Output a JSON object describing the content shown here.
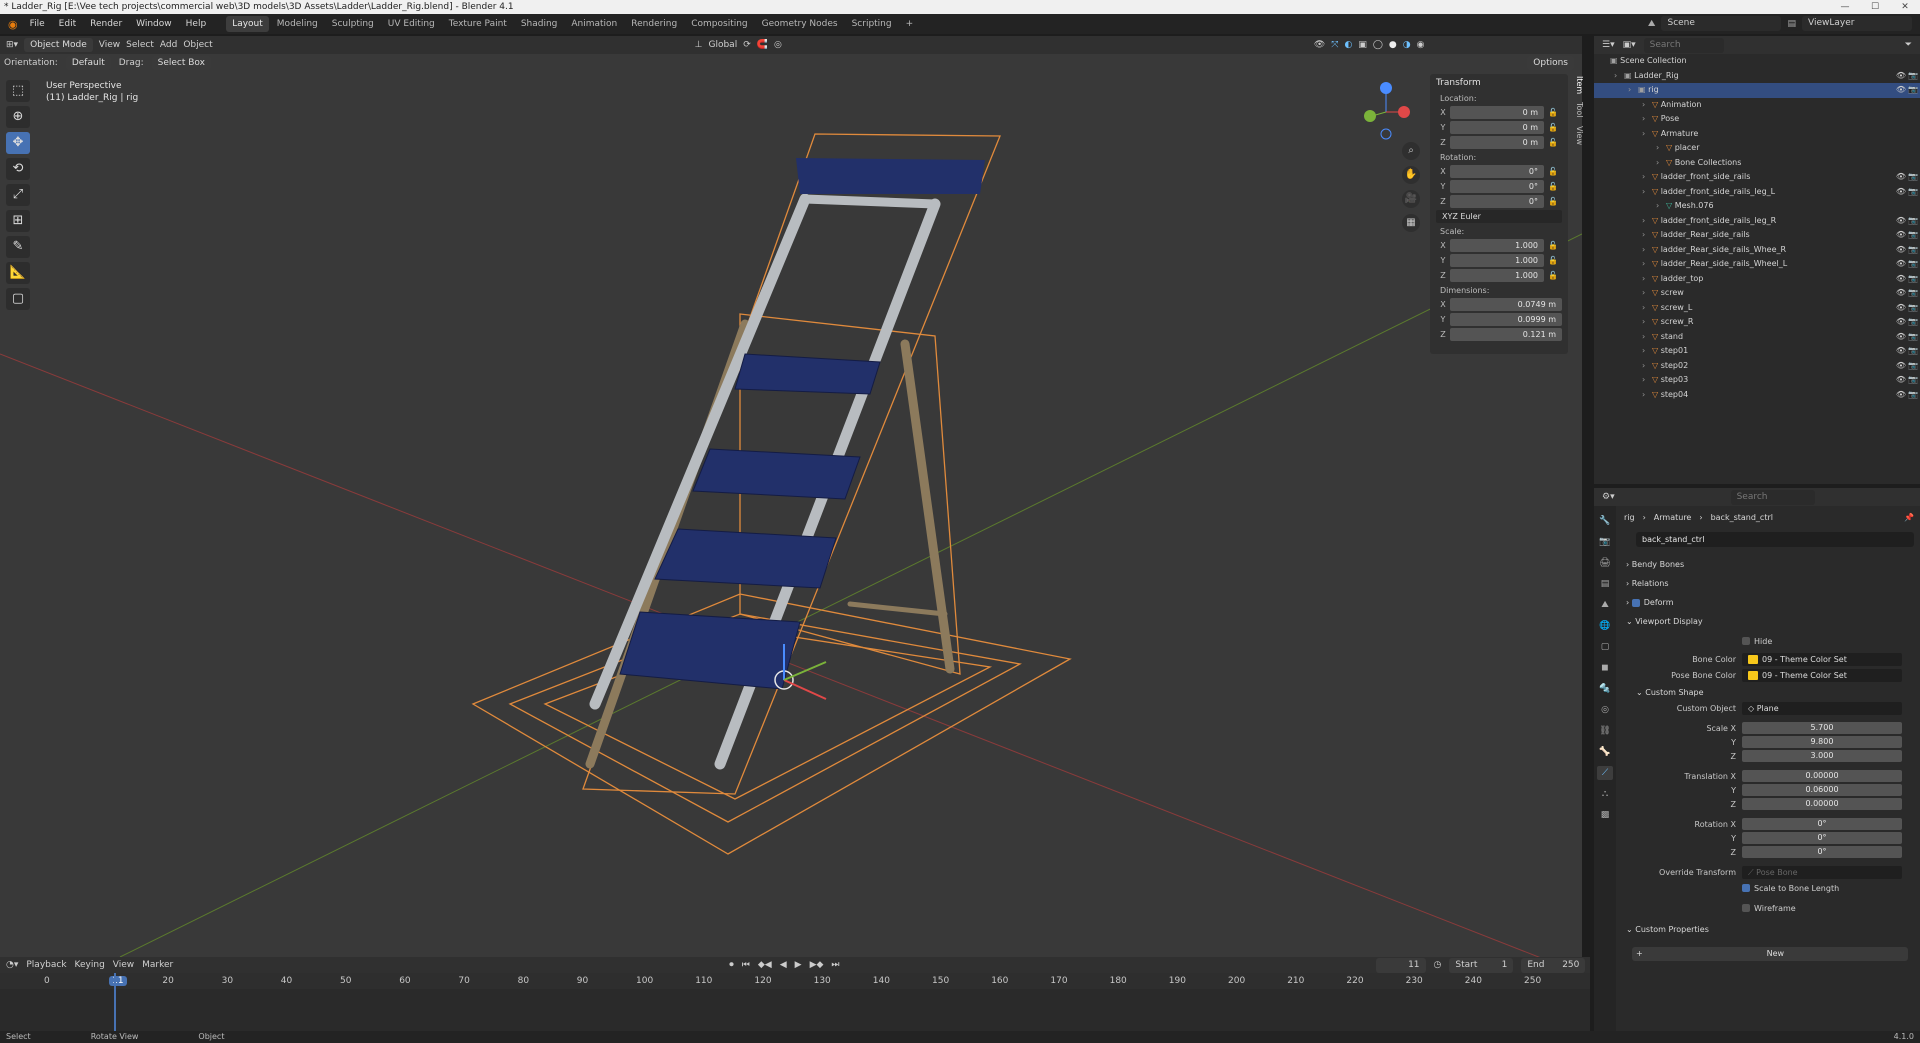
{
  "window": {
    "title": "* Ladder_Rig [E:\\Vee tech projects\\commercial web\\3D models\\3D Assets\\Ladder\\Ladder_Rig.blend] - Blender 4.1"
  },
  "menu": [
    "File",
    "Edit",
    "Render",
    "Window",
    "Help"
  ],
  "workspaces": [
    "Layout",
    "Modeling",
    "Sculpting",
    "UV Editing",
    "Texture Paint",
    "Shading",
    "Animation",
    "Rendering",
    "Compositing",
    "Geometry Nodes",
    "Scripting",
    "+"
  ],
  "active_workspace": "Layout",
  "scene": {
    "name": "Scene",
    "view_layer": "ViewLayer"
  },
  "viewport": {
    "mode": "Object Mode",
    "menus": [
      "View",
      "Select",
      "Add",
      "Object"
    ],
    "transform_orientation": "Global",
    "orientation_label": "Orientation:",
    "orientation_value": "Default",
    "drag_label": "Drag:",
    "drag_value": "Select Box",
    "options": "Options",
    "info_line1": "User Perspective",
    "info_line2": "(11) Ladder_Rig | rig",
    "side_tabs": [
      "Item",
      "Tool",
      "View"
    ]
  },
  "transform_panel": {
    "title": "Transform",
    "location_label": "Location:",
    "location": {
      "x": "0 m",
      "y": "0 m",
      "z": "0 m"
    },
    "rotation_label": "Rotation:",
    "rotation": {
      "x": "0°",
      "y": "0°",
      "z": "0°"
    },
    "rotation_mode": "XYZ Euler",
    "scale_label": "Scale:",
    "scale": {
      "x": "1.000",
      "y": "1.000",
      "z": "1.000"
    },
    "dimensions_label": "Dimensions:",
    "dimensions": {
      "x": "0.0749 m",
      "y": "0.0999 m",
      "z": "0.121 m"
    }
  },
  "timeline": {
    "menus": [
      "Playback",
      "Keying",
      "View",
      "Marker"
    ],
    "current_frame": "11",
    "start_label": "Start",
    "start": "1",
    "end_label": "End",
    "end": "250",
    "ticks": [
      "0",
      "11",
      "20",
      "30",
      "40",
      "50",
      "60",
      "70",
      "80",
      "90",
      "100",
      "110",
      "120",
      "130",
      "140",
      "150",
      "160",
      "170",
      "180",
      "190",
      "200",
      "210",
      "220",
      "230",
      "240",
      "250"
    ]
  },
  "statusbar": [
    "Select",
    "Rotate View",
    "Object",
    "4.1.0"
  ],
  "outliner": {
    "search_placeholder": "Search",
    "rows": [
      {
        "label": "Scene Collection",
        "indent": 0
      },
      {
        "label": "Ladder_Rig",
        "indent": 1
      },
      {
        "label": "rig",
        "indent": 2,
        "selected": true
      },
      {
        "label": "Animation",
        "indent": 3
      },
      {
        "label": "Pose",
        "indent": 3
      },
      {
        "label": "Armature",
        "indent": 3
      },
      {
        "label": "placer",
        "indent": 4
      },
      {
        "label": "Bone Collections",
        "indent": 4
      },
      {
        "label": "ladder_front_side_rails",
        "indent": 3
      },
      {
        "label": "ladder_front_side_rails_leg_L",
        "indent": 3
      },
      {
        "label": "Mesh.076",
        "indent": 4
      },
      {
        "label": "ladder_front_side_rails_leg_R",
        "indent": 3
      },
      {
        "label": "ladder_Rear_side_rails",
        "indent": 3
      },
      {
        "label": "ladder_Rear_side_rails_Whee_R",
        "indent": 3
      },
      {
        "label": "ladder_Rear_side_rails_Wheel_L",
        "indent": 3
      },
      {
        "label": "ladder_top",
        "indent": 3
      },
      {
        "label": "screw",
        "indent": 3
      },
      {
        "label": "screw_L",
        "indent": 3
      },
      {
        "label": "screw_R",
        "indent": 3
      },
      {
        "label": "stand",
        "indent": 3
      },
      {
        "label": "step01",
        "indent": 3
      },
      {
        "label": "step02",
        "indent": 3
      },
      {
        "label": "step03",
        "indent": 3
      },
      {
        "label": "step04",
        "indent": 3
      }
    ]
  },
  "properties": {
    "search_placeholder": "Search",
    "breadcrumb": [
      "rig",
      "Armature",
      "back_stand_ctrl"
    ],
    "bone_name": "back_stand_ctrl",
    "panels": {
      "bendy_bones": "Bendy Bones",
      "relations": "Relations",
      "deform": "Deform",
      "viewport_display": "Viewport Display",
      "hide": "Hide",
      "bone_color_label": "Bone Color",
      "bone_color": "09 - Theme Color Set",
      "pose_bone_color_label": "Pose Bone Color",
      "pose_bone_color": "09 - Theme Color Set",
      "custom_shape": "Custom Shape",
      "custom_object_label": "Custom Object",
      "custom_object": "Plane",
      "scale_x_label": "Scale X",
      "scale_x": "5.700",
      "scale_y": "9.800",
      "scale_z": "3.000",
      "translation_x_label": "Translation X",
      "translation_x": "0.00000",
      "translation_y": "0.06000",
      "translation_z": "0.00000",
      "rotation_x_label": "Rotation X",
      "rotation_x": "0°",
      "rotation_y": "0°",
      "rotation_z": "0°",
      "y_label": "Y",
      "z_label": "Z",
      "override_transform_label": "Override Transform",
      "override_placeholder": "Pose Bone",
      "scale_to_bone_length": "Scale to Bone Length",
      "wireframe": "Wireframe",
      "custom_properties": "Custom Properties",
      "new_button": "New"
    }
  },
  "colors": {
    "accent": "#4772b3",
    "selection_outline": "#e08a3c",
    "step_blue": "#22306a",
    "bone_color": "#f7c81b"
  }
}
